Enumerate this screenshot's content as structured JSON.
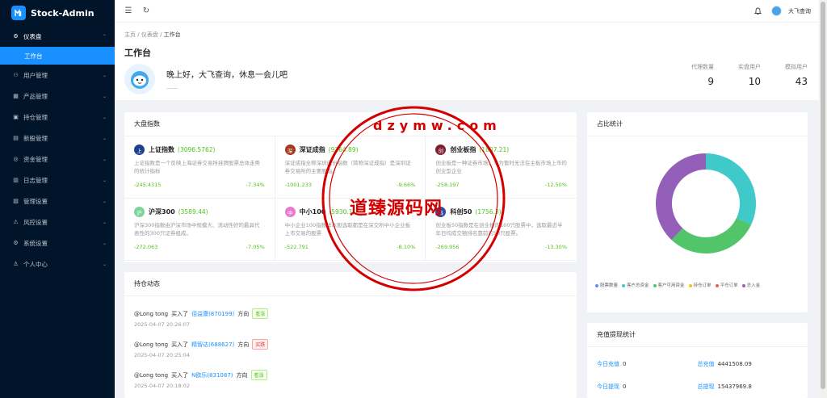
{
  "app": {
    "name": "Stock-Admin"
  },
  "sidebar": {
    "items": [
      {
        "icon": "dashboard-icon",
        "glyph": "⚙",
        "label": "仪表盘",
        "open": true,
        "sub": [
          {
            "label": "工作台"
          }
        ]
      },
      {
        "icon": "user-icon",
        "glyph": "⚇",
        "label": "用户管理"
      },
      {
        "icon": "product-icon",
        "glyph": "▦",
        "label": "产品管理"
      },
      {
        "icon": "position-icon",
        "glyph": "▣",
        "label": "持仓管理"
      },
      {
        "icon": "new-stock-icon",
        "glyph": "▤",
        "label": "新股管理"
      },
      {
        "icon": "fund-icon",
        "glyph": "◎",
        "label": "资金管理"
      },
      {
        "icon": "log-icon",
        "glyph": "▥",
        "label": "日志管理"
      },
      {
        "icon": "settings-icon",
        "glyph": "▧",
        "label": "管理设置"
      },
      {
        "icon": "risk-icon",
        "glyph": "⚠",
        "label": "风控设置"
      },
      {
        "icon": "system-icon",
        "glyph": "⚙",
        "label": "系统设置"
      },
      {
        "icon": "personal-icon",
        "glyph": "♙",
        "label": "个人中心"
      }
    ]
  },
  "topbar": {
    "user": "大飞查询"
  },
  "page": {
    "breadcrumb": [
      "主页",
      "/",
      "仪表盘",
      "/",
      "工作台"
    ],
    "title": "工作台",
    "greeting": "晚上好，大飞查询，休息一会儿吧",
    "greeting_sub": "——",
    "stats": [
      {
        "label": "代理数量",
        "value": "9"
      },
      {
        "label": "实盘用户",
        "value": "10"
      },
      {
        "label": "模拟用户",
        "value": "43"
      }
    ]
  },
  "market": {
    "title": "大盘指数",
    "items": [
      {
        "badge": "上",
        "color": "#1d3f8c",
        "name": "上证指数",
        "price": "(3096.5762)",
        "desc": "上证指数是一个反映上海证券交易所挂牌股票总体走势的统计指标",
        "change": "-245.4315",
        "pct": "-7.34%"
      },
      {
        "badge": "深",
        "color": "#a63a1f",
        "name": "深证成指",
        "price": "(9364.89)",
        "desc": "深证成指全称深圳成份指数（简称深证成指）是深圳证券交易所的主要股指。",
        "change": "-1001.233",
        "pct": "-9.66%"
      },
      {
        "badge": "创",
        "color": "#7a1f2e",
        "name": "创业板指",
        "price": "(1807.21)",
        "desc": "创业板是一种证券市场，专为暂时无法在主板市场上市的创业型企业",
        "change": "-258.197",
        "pct": "-12.50%"
      },
      {
        "badge": "沪",
        "color": "#7bd49a",
        "name": "沪深300",
        "price": "(3589.44)",
        "desc": "沪深300指数由沪深市场中规模大、流动性好的最具代表性的300只证券组成。",
        "change": "-272.063",
        "pct": "-7.05%"
      },
      {
        "badge": "中",
        "color": "#e87bd0",
        "name": "中小100",
        "price": "(5930.1)",
        "desc": "中小企业100指数样本股选取都是在深交所中小企业板上市交易的股票",
        "change": "-522.791",
        "pct": "-8.10%"
      },
      {
        "badge": "科",
        "color": "#2c4a9e",
        "name": "科创50",
        "price": "(1756.3)",
        "desc": "创业板50指数是在创业板的100只股票中，选取最近半年日均成交额排名靠前的50只股票。",
        "change": "-269.956",
        "pct": "-13.30%"
      }
    ]
  },
  "holding": {
    "title": "持仓动态",
    "items": [
      {
        "user": "@Long tong",
        "action": "买入了",
        "stock": "佰益康(870199)",
        "dir": "方向",
        "tag": "看涨",
        "type": "buy",
        "time": "2025-04-07 20:26:07"
      },
      {
        "user": "@Long tong",
        "action": "买入了",
        "stock": "精智达(688627)",
        "dir": "方向",
        "tag": "买跌",
        "type": "sell",
        "time": "2025-04-07 20:25:04"
      },
      {
        "user": "@Long tong",
        "action": "买入了",
        "stock": "N欧乐(831087)",
        "dir": "方向",
        "tag": "看涨",
        "type": "buy",
        "time": "2025-04-07 20:18:02"
      }
    ]
  },
  "ratio": {
    "title": "占比统计",
    "legend": [
      {
        "label": "股票数量",
        "color": "#5b8ff9"
      },
      {
        "label": "客户总资金",
        "color": "#3fc9c9"
      },
      {
        "label": "客户可用资金",
        "color": "#52c46a"
      },
      {
        "label": "持仓订单",
        "color": "#f6c022"
      },
      {
        "label": "平仓订单",
        "color": "#e86452"
      },
      {
        "label": "总入金",
        "color": "#945fb9"
      }
    ],
    "slices": [
      {
        "color": "#3fc9c9",
        "value": 32
      },
      {
        "color": "#52c46a",
        "value": 30
      },
      {
        "color": "#945fb9",
        "value": 38
      }
    ]
  },
  "charge": {
    "title": "充值提现统计",
    "rows": [
      {
        "k": "今日充值",
        "v": "0"
      },
      {
        "k": "总充值",
        "v": "4441508.09"
      },
      {
        "k": "今日提现",
        "v": "0"
      },
      {
        "k": "总提现",
        "v": "15437969.8"
      }
    ]
  },
  "watermark": {
    "text": "道臻源码网",
    "letters": "dzymw.com"
  }
}
